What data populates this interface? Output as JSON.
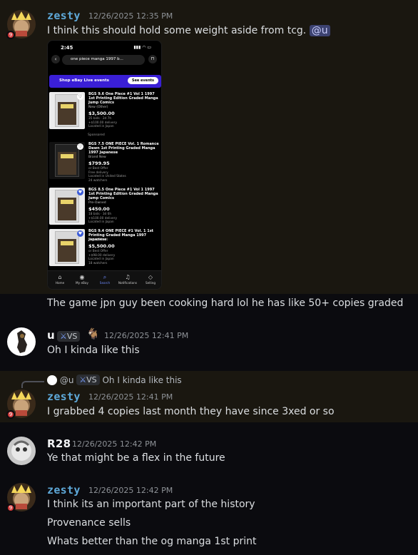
{
  "messages": [
    {
      "author": "zesty",
      "timestamp": "12/26/2025 12:35 PM",
      "text": "I think this should hold some weight aside from tcg.",
      "mention": "@u",
      "embed": {
        "status_time": "2:45",
        "search_text": "one piece manga 1997 b...",
        "live_label": "Shop eBay Live events",
        "live_button": "See events",
        "sponsored": "Sponsored",
        "items": [
          {
            "title": "BGS 9.6 One Piece #1 Vol 1 1997 1st Printing Edition Graded Manga Jump Comics",
            "condition": "New (Other)",
            "price": "$3,500.00",
            "meta": "35 bids · 2d 7h\n+$100.00 delivery\nLocated in Japan"
          },
          {
            "title": "BGS 7.5 ONE PIECE Vol. 1 Romance Dawn 1st Printing Graded Manga 1997 Japanese",
            "condition": "Brand New",
            "price": "$799.95",
            "meta": "or Best Offer\nFree delivery\nLocated in United States\n24 watchers"
          },
          {
            "title": "BGS 8.5 One Piece #1 Vol 1 1997 1st Printing Edition Graded Manga Jump Comics",
            "condition": "Pre-Owned",
            "price": "$450.00",
            "meta": "18 bids · 3d 6h\n+$100.00 delivery\nLocated in Japan"
          },
          {
            "title": "BGS 9.4 ONE PIECE #1 Vol. 1 1st Printing Graded Manga 1997 Japanese",
            "condition": "New (Other)",
            "price": "$5,500.00",
            "meta": "or Best Offer\n+$98.00 delivery\nLocated in Japan\n18 watchers"
          }
        ],
        "nav": [
          "Home",
          "My eBay",
          "Search",
          "Notifications",
          "Selling"
        ]
      },
      "followup": "The game jpn guy been cooking hard lol he has like 50+ copies graded"
    },
    {
      "author": "u",
      "tag": "VS",
      "timestamp": "12/26/2025 12:41 PM",
      "text": "Oh I kinda like this"
    },
    {
      "reply_author": "@u",
      "reply_tag": "VS",
      "reply_text": "Oh I kinda like this",
      "author": "zesty",
      "timestamp": "12/26/2025 12:41 PM",
      "text": "I grabbed 4 copies last month they have since 3xed or so"
    },
    {
      "author": "R28",
      "timestamp": "12/26/2025 12:42 PM",
      "text": "Ye that might be a flex in the future"
    },
    {
      "author": "zesty",
      "timestamp": "12/26/2025 12:42 PM",
      "lines": [
        "I think its an important part of the history",
        "Provenance sells",
        "Whats better than the og manga 1st print"
      ]
    }
  ],
  "colors": {
    "zesty_name": "#5ea8d8",
    "background": "#0b0b0f",
    "highlight": "#1a1710",
    "mention_bg": "#3c4270",
    "ebay_live": "#3a1fd6"
  }
}
